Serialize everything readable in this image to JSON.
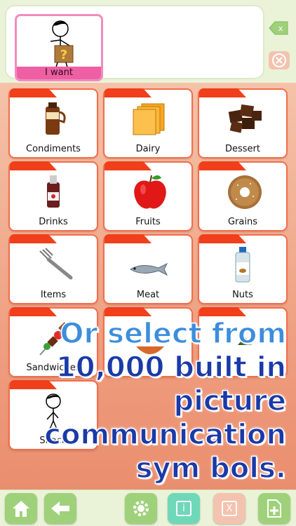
{
  "sentence_strip": {
    "card_label": "I want"
  },
  "categories": [
    {
      "label": "Condiments",
      "icon": "condiment-bottle-icon"
    },
    {
      "label": "Dairy",
      "icon": "cheese-slices-icon"
    },
    {
      "label": "Dessert",
      "icon": "chocolate-pieces-icon"
    },
    {
      "label": "Drinks",
      "icon": "drink-bottle-icon"
    },
    {
      "label": "Fruits",
      "icon": "apple-icon"
    },
    {
      "label": "Grains",
      "icon": "bagel-icon"
    },
    {
      "label": "Items",
      "icon": "fork-icon"
    },
    {
      "label": "Meat",
      "icon": "fish-icon"
    },
    {
      "label": "Nuts",
      "icon": "almond-extract-icon"
    },
    {
      "label": "Sandwiches",
      "icon": "kebab-icon"
    },
    {
      "label": "",
      "icon": "bowl-icon"
    },
    {
      "label": "",
      "icon": "plant-icon"
    },
    {
      "label": "Snack",
      "icon": "child-figure-icon"
    }
  ],
  "promo": {
    "line1": "Or select from",
    "line2": "10,000 built in",
    "line3": "picture",
    "line4": "communication",
    "line5": "sym bols."
  },
  "toolbar": {
    "info_label": "i",
    "cancel_label": "X"
  },
  "colors": {
    "accent_red": "#f03f1a",
    "accent_pink": "#ee5fa3",
    "toolbar_green": "#9fd17a",
    "promo_blue": "#1a3aa8"
  }
}
